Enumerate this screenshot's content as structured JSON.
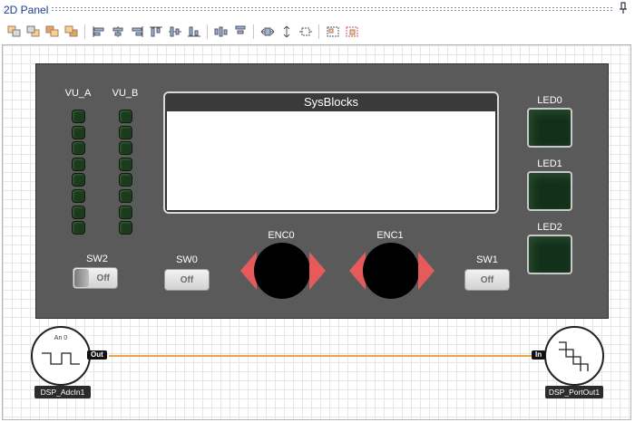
{
  "window": {
    "title": "2D Panel",
    "pin_icon": "pin-icon"
  },
  "toolbar": {
    "groups": [
      [
        "bring-forward-icon",
        "send-backward-icon",
        "bring-to-front-icon",
        "send-to-back-icon"
      ],
      [
        "align-left-icon",
        "align-center-icon",
        "align-right-icon",
        "align-top-icon",
        "align-middle-icon",
        "align-bottom-icon"
      ],
      [
        "distribute-horizontal-icon",
        "distribute-vertical-icon"
      ],
      [
        "same-width-icon",
        "same-height-icon",
        "same-size-icon"
      ],
      [
        "group-icon",
        "ungroup-icon"
      ]
    ]
  },
  "panel": {
    "vu_a_label": "VU_A",
    "vu_b_label": "VU_B",
    "display_title": "SysBlocks",
    "led0_label": "LED0",
    "led1_label": "LED1",
    "led2_label": "LED2",
    "sw0": {
      "label": "SW0",
      "state": "Off"
    },
    "sw1": {
      "label": "SW1",
      "state": "Off"
    },
    "sw2": {
      "label": "SW2",
      "state": "Off"
    },
    "enc0_label": "ENC0",
    "enc1_label": "ENC1",
    "vu_led_count": 8,
    "colors": {
      "panel": "#5a5a5a",
      "led_off": "#1c3a1c",
      "arrow": "#e55a5a",
      "wire": "#f0a24a"
    }
  },
  "blocks": {
    "adc": {
      "name": "DSP_AdcIn1",
      "caption": "An 0",
      "port": "Out"
    },
    "portout": {
      "name": "DSP_PortOut1",
      "port": "In"
    }
  }
}
